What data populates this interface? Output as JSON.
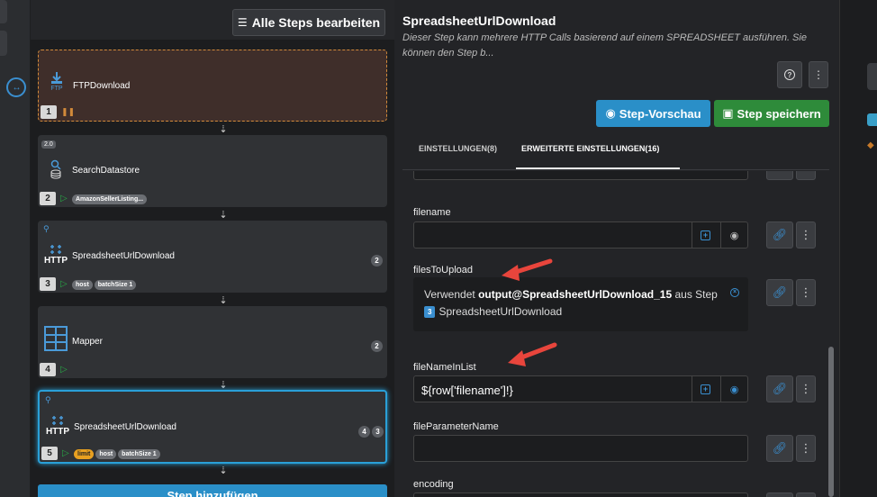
{
  "toolbar": {
    "edit_all_label": "Alle Steps bearbeiten"
  },
  "steps": [
    {
      "number": "1",
      "name": "FTPDownload"
    },
    {
      "number": "2",
      "name": "SearchDatastore",
      "version": "2.0",
      "tags": [
        "AmazonSellerListing..."
      ]
    },
    {
      "number": "3",
      "name": "SpreadsheetUrlDownload",
      "icon_text": "HTTP",
      "tags": [
        "host",
        "batchSize 1"
      ],
      "badges": [
        "2"
      ]
    },
    {
      "number": "4",
      "name": "Mapper",
      "badges": [
        "2"
      ]
    },
    {
      "number": "5",
      "name": "SpreadsheetUrlDownload",
      "icon_text": "HTTP",
      "tags": [
        "limit",
        "host",
        "batchSize 1"
      ],
      "badges": [
        "4",
        "3"
      ]
    }
  ],
  "add_step_label": "Step hinzufügen",
  "detail": {
    "title": "SpreadsheetUrlDownload",
    "description": "Dieser Step kann mehrere HTTP Calls basierend auf einem SPREADSHEET ausführen. Sie können den Step b...",
    "preview_label": "Step-Vorschau",
    "save_label": "Step speichern",
    "tabs": [
      {
        "label": "EINSTELLUNGEN(8)"
      },
      {
        "label": "ERWEITERTE EINSTELLUNGEN(16)"
      }
    ],
    "fields": {
      "filename": {
        "label": "filename",
        "value": ""
      },
      "filesToUpload": {
        "label": "filesToUpload",
        "ref_prefix": "Verwendet",
        "ref_output": "output@SpreadsheetUrlDownload_15",
        "ref_suffix": "aus Step",
        "ref_step_number": "3",
        "ref_step_name": "SpreadsheetUrlDownload"
      },
      "fileNameInList": {
        "label": "fileNameInList",
        "value": "${row['filename']!}"
      },
      "fileParameterName": {
        "label": "fileParameterName",
        "value": ""
      },
      "encoding": {
        "label": "encoding"
      }
    }
  },
  "colors": {
    "accent_blue": "#2a8fc8",
    "save_green": "#2e8b3a",
    "arrow_red": "#e8453c",
    "ftp_border": "#d28a3a",
    "limit_tag": "#e8a020"
  }
}
